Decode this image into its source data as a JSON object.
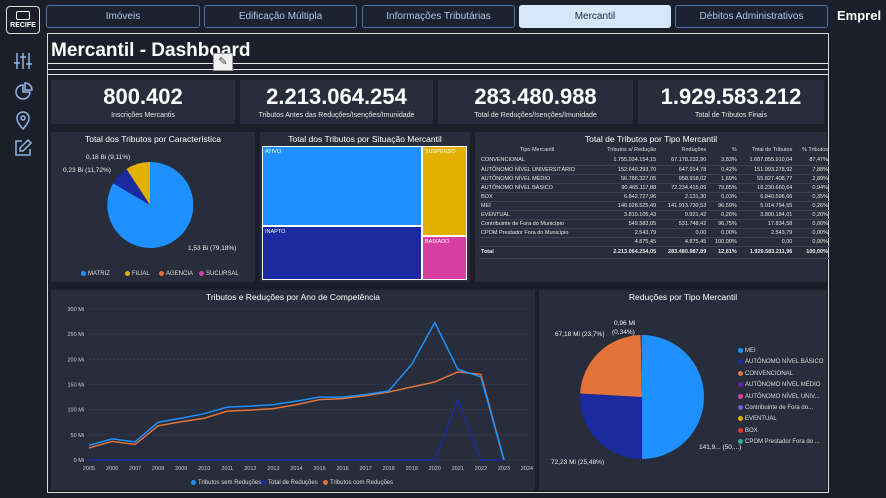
{
  "sidebar": {
    "logo_text": "RECIFE",
    "icons": [
      "sliders-icon",
      "pie-chart-icon",
      "map-pin-icon",
      "edit-icon"
    ]
  },
  "nav": {
    "tabs": [
      "Imóveis",
      "Edificação Múltipla",
      "Informações Tributárias",
      "Mercantil",
      "Débitos Administrativos"
    ],
    "active": "Mercantil",
    "brand": "Emprel"
  },
  "page_title": "Mercantil - Dashboard",
  "kpis": [
    {
      "value": "800.402",
      "label": "Inscrições Mercantis"
    },
    {
      "value": "2.213.064.254",
      "label": "Tributos Antes das Reduções/Isenções/Imunidade"
    },
    {
      "value": "283.480.988",
      "label": "Total de Reduções/Isenções/Imunidade"
    },
    {
      "value": "1.929.583.212",
      "label": "Total de Tributos Finais"
    }
  ],
  "pie1": {
    "title": "Total dos Tributos por Característica",
    "labels": [
      "0,18 Bi (9,11%)",
      "0,23 Bi (11,72%)",
      "1,53 Bi (79,18%)"
    ],
    "legend": [
      "MATRIZ",
      "FILIAL",
      "AGENCIA",
      "SUCURSAL"
    ]
  },
  "treemap": {
    "title": "Total dos Tributos por Situação Mercantil",
    "labels": [
      "ATIVO",
      "SUSPENSO",
      "INAPTO",
      "BAIXADO"
    ]
  },
  "table": {
    "title": "Total de Tributos por Tipo Mercantil",
    "headers": [
      "Tipo Mercantil",
      "Tributos s/ Redução",
      "Reduções",
      "%",
      "Total de Tributos",
      "% Tributos"
    ],
    "rows": [
      [
        "CONVENCIONAL",
        "1.755.034.154,15",
        "67.178.232,90",
        "3,83%",
        "1.687.855.910,04",
        "87,47%"
      ],
      [
        "AUTÔNOMO NÍVEL UNIVERSITÁRIO",
        "152.640.293,70",
        "647.014,78",
        "0,42%",
        "151.993.278,92",
        "7,88%"
      ],
      [
        "AUTÔNOMO NÍVEL MÉDIO",
        "56.786.327,05",
        "958.918,02",
        "1,69%",
        "55.827.408,77",
        "2,89%"
      ],
      [
        "AUTÔNOMO NÍVEL BÁSICO",
        "90.465.117,88",
        "72.234.415,09",
        "79,85%",
        "18.230.660,64",
        "0,94%"
      ],
      [
        "BOX",
        "6.842.727,96",
        "2.131,30",
        "0,03%",
        "6.840.596,66",
        "0,35%"
      ],
      [
        "MEI",
        "146.928.525,49",
        "141.913.730,53",
        "96,59%",
        "5.014.794,55",
        "0,26%"
      ],
      [
        "EVENTUAL",
        "3.810.105,43",
        "9.921,42",
        "0,26%",
        "3.800.184,01",
        "0,20%"
      ],
      [
        "Contribuinte de Fora do Município",
        "549.583,05",
        "531.748,42",
        "96,75%",
        "17.834,58",
        "0,00%"
      ],
      [
        "CPOM Prestador Fora do Município",
        "2.543,79",
        "0,00",
        "0,00%",
        "2.543,79",
        "0,00%"
      ],
      [
        "",
        "4.875,45",
        "4.875,45",
        "100,00%",
        "0,00",
        "0,00%"
      ]
    ],
    "total": [
      "Total",
      "2.213.064.254,05",
      "283.480.987,89",
      "12,81%",
      "1.929.583.211,96",
      "100,00%"
    ]
  },
  "line_chart_title": "Tributos e Reduções por Ano de Competência",
  "line_legend": [
    "Tributos sem Reduções",
    "Total de Reduções",
    "Tributos com Reduções"
  ],
  "chart_data": {
    "type": "line",
    "title": "Tributos e Reduções por Ano de Competência",
    "x": [
      "2005",
      "2006",
      "2007",
      "2008",
      "2009",
      "2010",
      "2011",
      "2012",
      "2013",
      "2014",
      "2015",
      "2016",
      "2017",
      "2018",
      "2019",
      "2020",
      "2021",
      "2022",
      "2023",
      "2024"
    ],
    "ylim": [
      0,
      300
    ],
    "yticks": [
      "0 Mi",
      "50 Mi",
      "100 Mi",
      "150 Mi",
      "200 Mi",
      "250 Mi",
      "300 Mi"
    ],
    "series": [
      {
        "name": "Tributos sem Reduções",
        "color": "#1e90ff",
        "values": [
          29,
          42,
          36,
          75,
          83,
          92,
          105,
          107,
          110,
          117,
          125,
          125,
          130,
          137,
          190,
          273,
          180,
          165,
          0
        ]
      },
      {
        "name": "Total de Reduções",
        "color": "#1a2aa0",
        "values": [
          0,
          0,
          0,
          0,
          0,
          0,
          0,
          0,
          0,
          0,
          0,
          0,
          0,
          0,
          0,
          0,
          120,
          0,
          0
        ]
      },
      {
        "name": "Tributos com Reduções",
        "color": "#e3733a",
        "values": [
          24,
          37,
          31,
          68,
          76,
          83,
          97,
          99,
          102,
          110,
          120,
          122,
          128,
          135,
          145,
          155,
          175,
          170,
          0
        ]
      }
    ]
  },
  "pie2": {
    "title": "Reduções por Tipo Mercantil",
    "labels": [
      "0,96 Mi",
      "(0,34%)",
      "67,18 Mi (23,7%)",
      "141,9... (50,...)",
      "72,23 Mi (25,48%)"
    ],
    "legend": [
      {
        "name": "MEI",
        "color": "#1e90ff"
      },
      {
        "name": "AUTÔNOMO NÍVEL BÁSICO",
        "color": "#1a2aa0"
      },
      {
        "name": "CONVENCIONAL",
        "color": "#e3733a"
      },
      {
        "name": "AUTÔNOMO NÍVEL MÉDIO",
        "color": "#6b1fb0"
      },
      {
        "name": "AUTÔNOMO NÍVEL UNIV...",
        "color": "#d63fa0"
      },
      {
        "name": "Contribuinte de Fora do...",
        "color": "#6a5fd6"
      },
      {
        "name": "EVENTUAL",
        "color": "#e3b000"
      },
      {
        "name": "BOX",
        "color": "#e1382d"
      },
      {
        "name": "CPOM Prestador Fora do ...",
        "color": "#2ab0a0"
      }
    ]
  }
}
